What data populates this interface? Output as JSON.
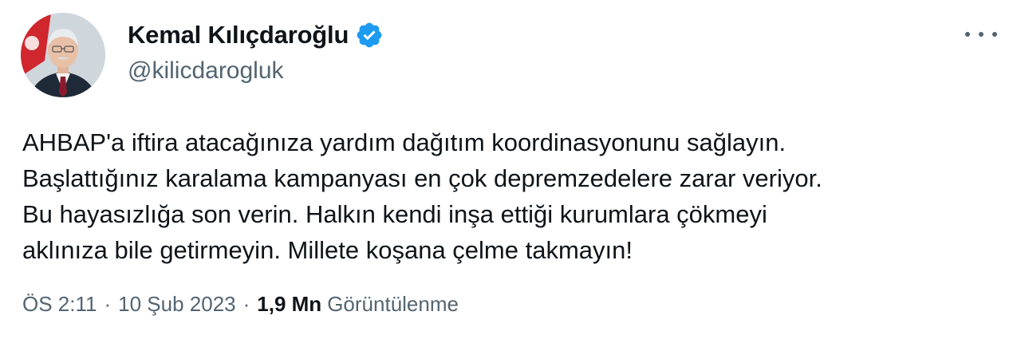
{
  "author": {
    "display_name": "Kemal Kılıçdaroğlu",
    "handle": "@kilicdarogluk",
    "verified_icon": "verified-badge-icon",
    "verified_color": "#1d9bf0"
  },
  "tweet": {
    "lines": [
      "AHBAP'a iftira atacağınıza yardım dağıtım koordinasyonunu sağlayın.",
      "Başlattığınız karalama kampanyası en çok depremzedelere zarar veriyor.",
      "Bu hayasızlığa son verin. Halkın kendi inşa ettiği kurumlara çökmeyi",
      "aklınıza bile getirmeyin. Millete koşana çelme takmayın!"
    ]
  },
  "meta": {
    "time": "ÖS 2:11",
    "separator": "·",
    "date": "10 Şub 2023",
    "views_count": "1,9 Mn",
    "views_label": "Görüntülenme"
  },
  "more_icon": "more-options-icon",
  "colors": {
    "text": "#0f1419",
    "secondary": "#536471",
    "accent": "#1d9bf0"
  }
}
